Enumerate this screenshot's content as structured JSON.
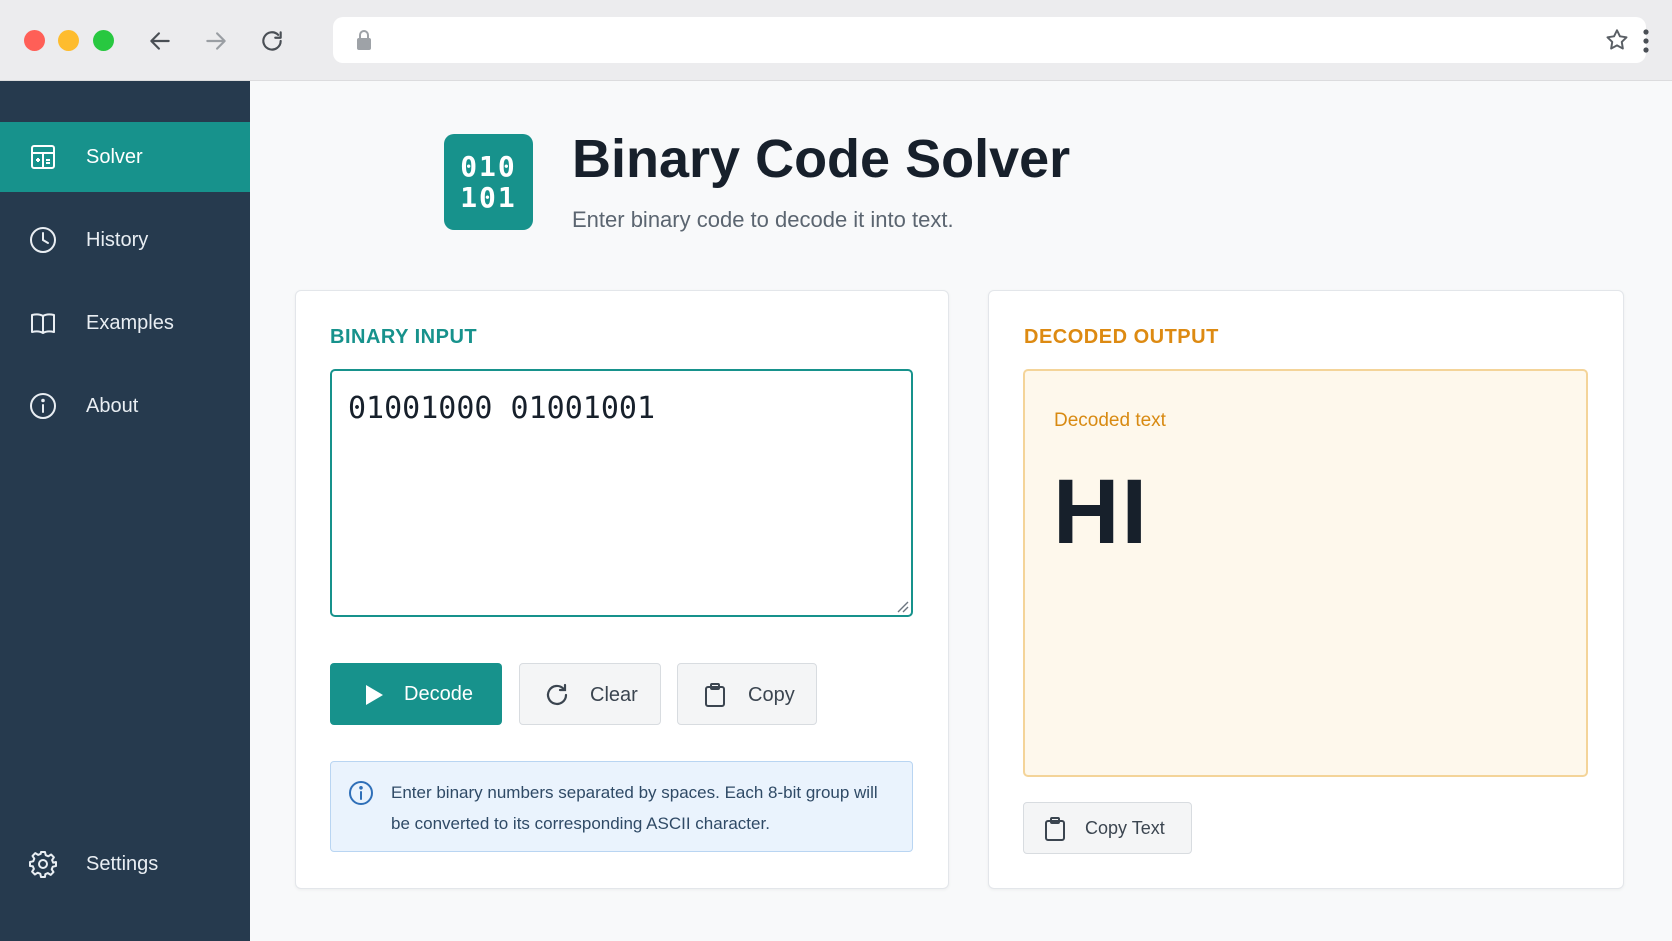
{
  "browser": {
    "icons": {
      "back": "arrow-left-icon",
      "forward": "arrow-right-icon",
      "reload": "reload-icon",
      "lock": "lock-icon",
      "bookmark": "star-icon",
      "menu": "kebab-menu-icon"
    }
  },
  "sidebar": {
    "items": [
      {
        "label": "Solver",
        "icon": "calculator-icon",
        "active": true
      },
      {
        "label": "History",
        "icon": "clock-icon",
        "active": false
      },
      {
        "label": "Examples",
        "icon": "book-icon",
        "active": false
      },
      {
        "label": "About",
        "icon": "info-icon",
        "active": false
      }
    ],
    "settings": {
      "label": "Settings",
      "icon": "gear-icon"
    }
  },
  "header": {
    "logo_line1": "010",
    "logo_line2": "101",
    "title": "Binary Code Solver",
    "subtitle": "Enter binary code to decode it into text."
  },
  "input_panel": {
    "label": "BINARY INPUT",
    "value": "01001000 01001001",
    "buttons": {
      "decode": "Decode",
      "clear": "Clear",
      "copy": "Copy"
    },
    "info_text": "Enter binary numbers separated by spaces. Each 8-bit group will be converted to its corresponding ASCII character."
  },
  "output_panel": {
    "label": "DECODED OUTPUT",
    "caption": "Decoded text",
    "value": "HI",
    "copy_button": "Copy Text"
  },
  "colors": {
    "accent": "#17928c",
    "sidebar_bg": "#263a4e",
    "output_accent": "#dd8a12",
    "output_bg": "#fef8ec",
    "info_bg": "#eaf3fd"
  }
}
